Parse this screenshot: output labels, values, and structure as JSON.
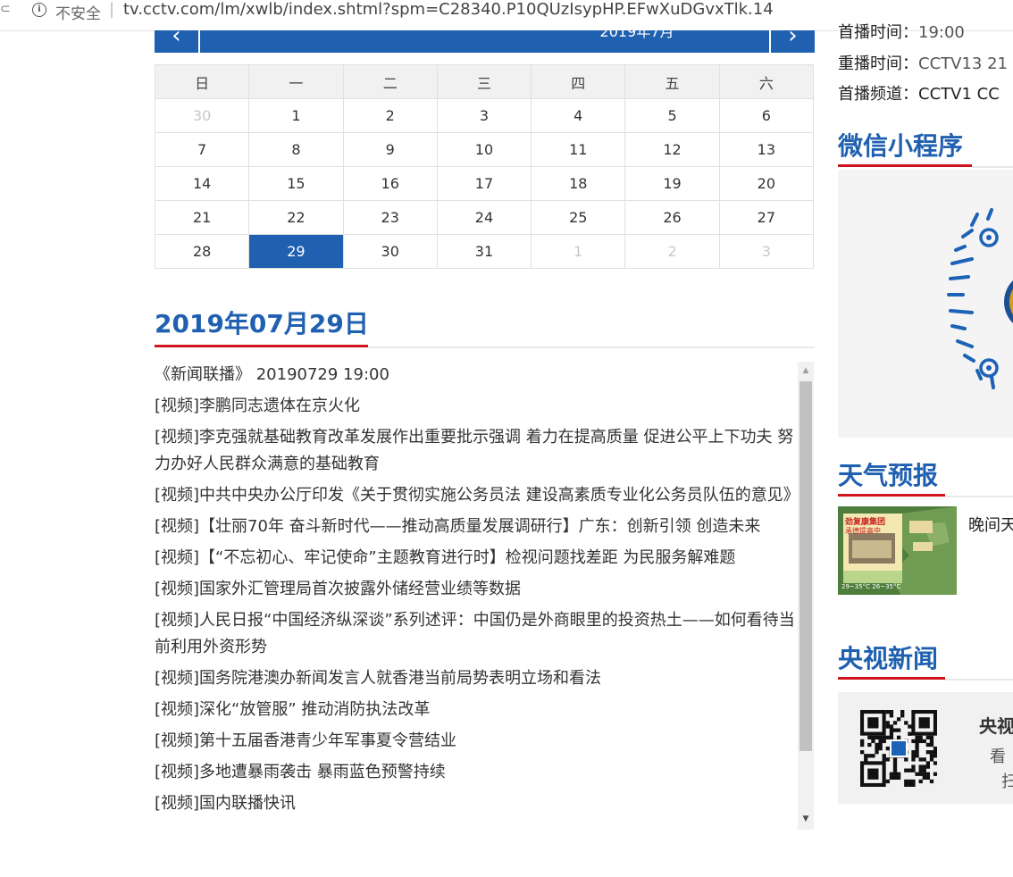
{
  "browser": {
    "back_glyph": "⊂",
    "info_glyph": "i",
    "secure_label": "不安全",
    "separator": "|",
    "url": "tv.cctv.com/lm/xwlb/index.shtml?spm=C28340.P10QUzIsypHP.EFwXuDGvxTlk.14"
  },
  "calendar": {
    "month_label": "2019年7月",
    "prev_glyph": "‹",
    "next_glyph": "›",
    "weekdays": [
      "日",
      "一",
      "二",
      "三",
      "四",
      "五",
      "六"
    ],
    "weeks": [
      [
        {
          "d": "30",
          "o": true
        },
        {
          "d": "1"
        },
        {
          "d": "2"
        },
        {
          "d": "3"
        },
        {
          "d": "4"
        },
        {
          "d": "5"
        },
        {
          "d": "6"
        }
      ],
      [
        {
          "d": "7"
        },
        {
          "d": "8"
        },
        {
          "d": "9"
        },
        {
          "d": "10"
        },
        {
          "d": "11"
        },
        {
          "d": "12"
        },
        {
          "d": "13"
        }
      ],
      [
        {
          "d": "14"
        },
        {
          "d": "15"
        },
        {
          "d": "16"
        },
        {
          "d": "17"
        },
        {
          "d": "18"
        },
        {
          "d": "19"
        },
        {
          "d": "20"
        }
      ],
      [
        {
          "d": "21"
        },
        {
          "d": "22"
        },
        {
          "d": "23"
        },
        {
          "d": "24"
        },
        {
          "d": "25"
        },
        {
          "d": "26"
        },
        {
          "d": "27"
        }
      ],
      [
        {
          "d": "28"
        },
        {
          "d": "29",
          "s": true
        },
        {
          "d": "30"
        },
        {
          "d": "31"
        },
        {
          "d": "1",
          "o": true
        },
        {
          "d": "2",
          "o": true
        },
        {
          "d": "3",
          "o": true
        }
      ]
    ],
    "selected_color": "#2060b0"
  },
  "main": {
    "date_title": "2019年07月29日",
    "program_header": "《新闻联播》 20190729 19:00",
    "items": [
      "[视频]李鹏同志遗体在京火化",
      "[视频]李克强就基础教育改革发展作出重要批示强调 着力在提高质量 促进公平上下功夫 努力办好人民群众满意的基础教育",
      "[视频]中共中央办公厅印发《关于贯彻实施公务员法 建设高素质专业化公务员队伍的意见》",
      "[视频]【壮丽70年 奋斗新时代——推动高质量发展调研行】广东：创新引领 创造未来",
      "[视频]【“不忘初心、牢记使命”主题教育进行时】检视问题找差距 为民服务解难题",
      "[视频]国家外汇管理局首次披露外储经营业绩等数据",
      "[视频]人民日报“中国经济纵深谈”系列述评：中国仍是外商眼里的投资热土——如何看待当前利用外资形势",
      "[视频]国务院港澳办新闻发言人就香港当前局势表明立场和看法",
      "[视频]深化“放管服” 推动消防执法改革",
      "[视频]第十五届香港青少年军事夏令营结业",
      "[视频]多地遭暴雨袭击 暴雨蓝色预警持续",
      "[视频]国内联播快讯"
    ]
  },
  "sidebar": {
    "premiere_time_label": "首播时间：",
    "premiere_time_value": "19:00",
    "rerun_label": "重播时间：",
    "rerun_value": "CCTV13 21",
    "channel_label": "首播频道：",
    "channel_value": "CCTV1  CC",
    "mini_program_title": "微信小程序",
    "weather_title": "天气预报",
    "weather_text": "晚间天",
    "weather_ad_line1": "劲复康集团",
    "weather_ad_line2": "承德提高中",
    "weather_temps": "29~35°C    26~35°C",
    "cctv_news_title": "央视新闻",
    "cctv_box_title": "央视",
    "cctv_box_sub1": "看",
    "cctv_box_sub2": "扫"
  },
  "colors": {
    "accent_blue": "#2060b0",
    "accent_red": "#d0151d"
  }
}
